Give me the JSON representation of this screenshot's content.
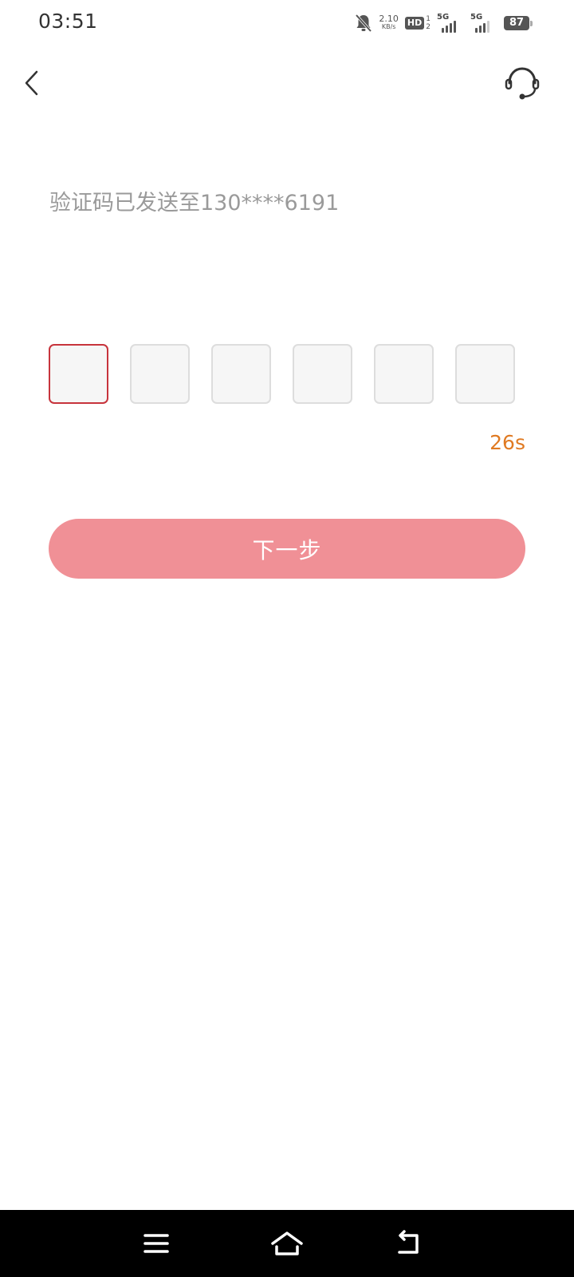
{
  "status_bar": {
    "time": "03:51",
    "net_speed_value": "2.10",
    "net_speed_unit": "KB/s",
    "hd_label": "HD",
    "sim_top": "1",
    "sim_bottom": "2",
    "sim1_network": "5G",
    "sim2_network": "5G",
    "battery_level": "87"
  },
  "verification": {
    "hint": "验证码已发送至130****6191",
    "code_length": 6,
    "countdown": "26s",
    "next_label": "下一步"
  },
  "colors": {
    "accent": "#c7343c",
    "button_bg": "#f09096",
    "countdown": "#e07a22",
    "hint_text": "#9a9a9a"
  }
}
